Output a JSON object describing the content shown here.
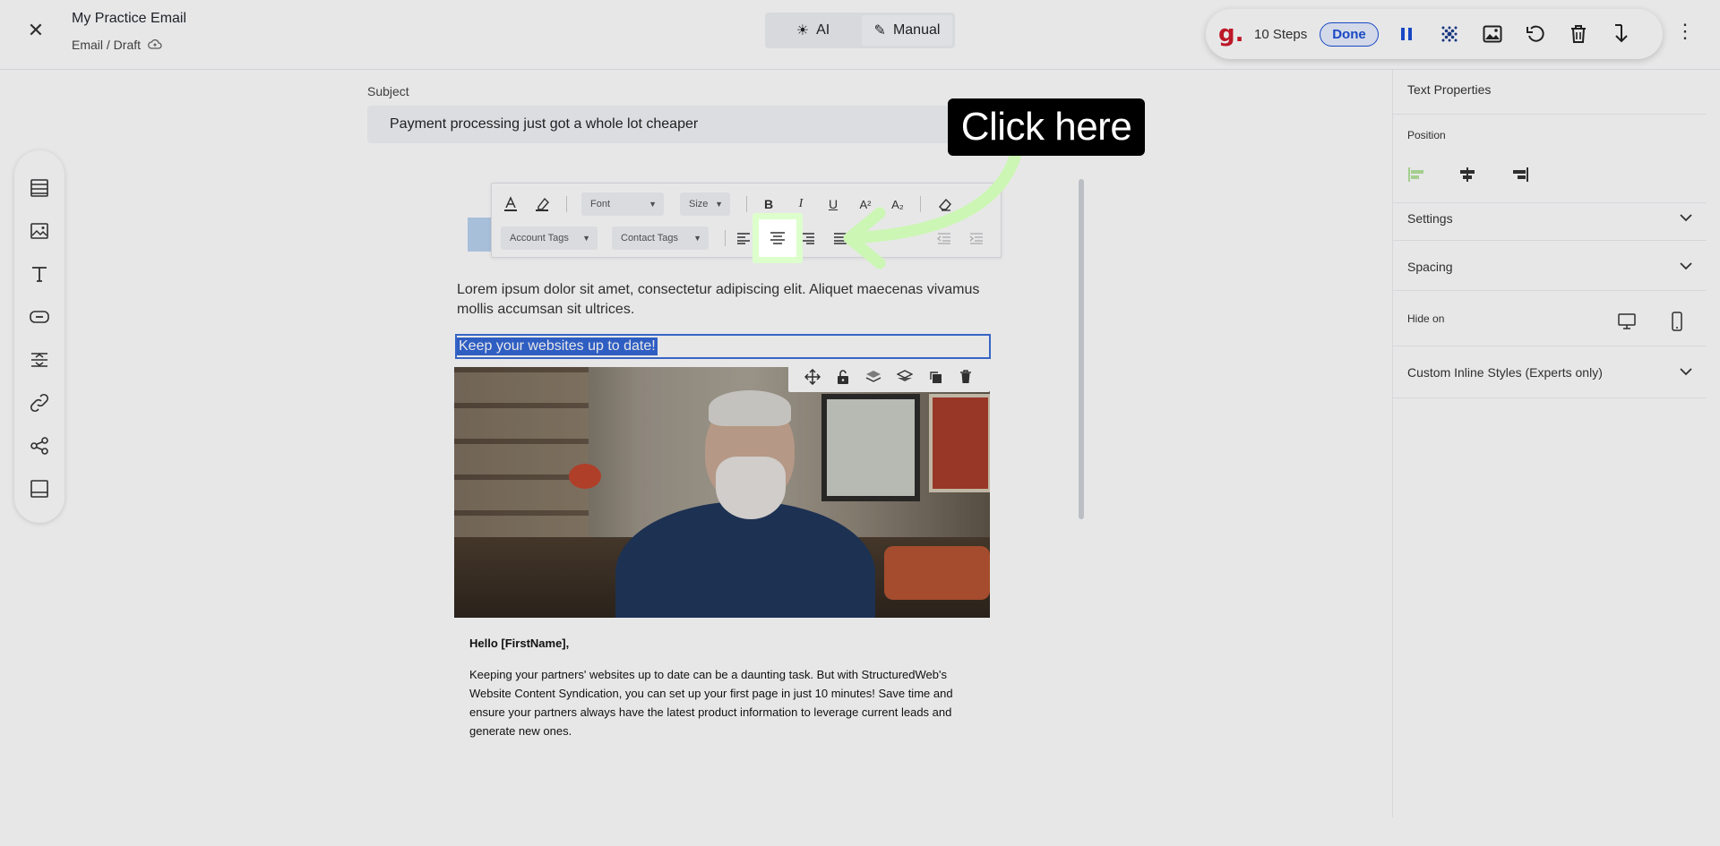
{
  "header": {
    "close_icon": "close-icon",
    "title": "My Practice Email",
    "subtitle": "Email / Draft",
    "cloud_icon": "cloud-sync-icon"
  },
  "mode_toggle": {
    "ai_label": "AI",
    "manual_label": "Manual",
    "active": "manual"
  },
  "recorder": {
    "logo": "g.",
    "steps": "10 Steps",
    "done_label": "Done",
    "icons": [
      "pause-icon",
      "blur-icon",
      "image-icon",
      "undo-icon",
      "delete-icon",
      "download-icon"
    ]
  },
  "left_rail": {
    "items": [
      "rows-icon",
      "image-icon",
      "text-icon",
      "button-icon",
      "divider-icon",
      "link-icon",
      "social-icon",
      "footer-icon"
    ]
  },
  "subject": {
    "label": "Subject",
    "value": "Payment processing just got a whole lot cheaper"
  },
  "toolbar": {
    "font_label": "Font",
    "size_label": "Size",
    "bold": "B",
    "italic": "I",
    "underline": "U",
    "superscript": "A²",
    "subscript": "A₂",
    "account_tags": "Account Tags",
    "contact_tags": "Contact Tags"
  },
  "email": {
    "lorem": "Lorem ipsum dolor sit amet, consectetur adipiscing elit. Aliquet maecenas vivamus mollis accumsan sit ultrices.",
    "selected_heading": "Keep your websites up to date!",
    "greeting": "Hello [FirstName],",
    "body": "Keeping your partners' websites up to date can be a daunting task. But with StructuredWeb's Website Content Syndication, you can set up your first page in just 10 minutes! Save time and ensure your partners always have the latest product information to leverage current leads and generate new ones."
  },
  "right_panel": {
    "header": "Text Properties",
    "position_label": "Position",
    "settings_label": "Settings",
    "spacing_label": "Spacing",
    "hide_on_label": "Hide on",
    "custom_styles_label": "Custom Inline Styles (Experts only)"
  },
  "callout": {
    "text": "Click here",
    "highlight_color": "#ddffcc"
  },
  "colors": {
    "accent": "#1a4fd6",
    "selection": "#3367d6",
    "brand_red": "#d0192a"
  }
}
